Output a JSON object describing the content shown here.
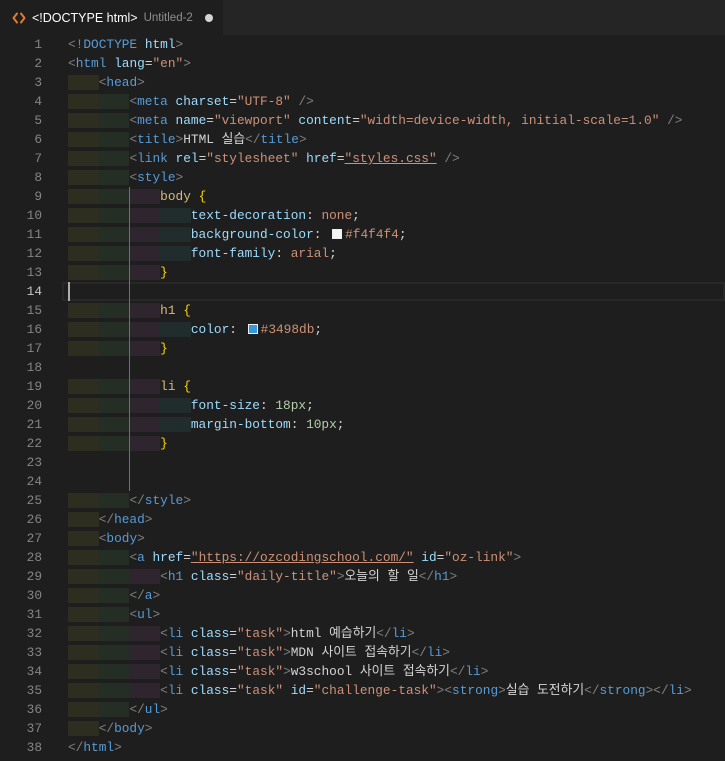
{
  "tab": {
    "icon": "html-file-icon",
    "title": "<!DOCTYPE html>",
    "file_name": "Untitled-2",
    "unsaved": true
  },
  "editor": {
    "active_line": 14,
    "lines": [
      {
        "n": 1,
        "tokens": [
          {
            "p": "<!"
          },
          {
            "tag": "DOCTYPE"
          },
          {
            "t": " "
          },
          {
            "attr": "html"
          },
          {
            "p": ">"
          }
        ]
      },
      {
        "n": 2,
        "tokens": [
          {
            "p": "<"
          },
          {
            "tag": "html"
          },
          {
            "t": " "
          },
          {
            "attr": "lang"
          },
          {
            "t": "="
          },
          {
            "str": "\"en\""
          },
          {
            "p": ">"
          }
        ]
      },
      {
        "n": 3,
        "tokens": [
          {
            "ws": "    "
          },
          {
            "p": "<"
          },
          {
            "tag": "head"
          },
          {
            "p": ">"
          }
        ]
      },
      {
        "n": 4,
        "tokens": [
          {
            "ws": "        "
          },
          {
            "p": "<"
          },
          {
            "tag": "meta"
          },
          {
            "t": " "
          },
          {
            "attr": "charset"
          },
          {
            "t": "="
          },
          {
            "str": "\"UTF-8\""
          },
          {
            "t": " "
          },
          {
            "p": "/>"
          }
        ]
      },
      {
        "n": 5,
        "tokens": [
          {
            "ws": "        "
          },
          {
            "p": "<"
          },
          {
            "tag": "meta"
          },
          {
            "t": " "
          },
          {
            "attr": "name"
          },
          {
            "t": "="
          },
          {
            "str": "\"viewport\""
          },
          {
            "t": " "
          },
          {
            "attr": "content"
          },
          {
            "t": "="
          },
          {
            "str": "\"width=device-width, initial-scale=1.0\""
          },
          {
            "t": " "
          },
          {
            "p": "/>"
          }
        ]
      },
      {
        "n": 6,
        "tokens": [
          {
            "ws": "        "
          },
          {
            "p": "<"
          },
          {
            "tag": "title"
          },
          {
            "p": ">"
          },
          {
            "t": "HTML 실습"
          },
          {
            "p": "</"
          },
          {
            "tag": "title"
          },
          {
            "p": ">"
          }
        ]
      },
      {
        "n": 7,
        "tokens": [
          {
            "ws": "        "
          },
          {
            "p": "<"
          },
          {
            "tag": "link"
          },
          {
            "t": " "
          },
          {
            "attr": "rel"
          },
          {
            "t": "="
          },
          {
            "str": "\"stylesheet\""
          },
          {
            "t": " "
          },
          {
            "attr": "href"
          },
          {
            "t": "="
          },
          {
            "link": "\"styles.css\""
          },
          {
            "t": " "
          },
          {
            "p": "/>"
          }
        ]
      },
      {
        "n": 8,
        "tokens": [
          {
            "ws": "        "
          },
          {
            "p": "<"
          },
          {
            "tag": "style"
          },
          {
            "p": ">"
          }
        ]
      },
      {
        "n": 9,
        "tokens": [
          {
            "ws": "            "
          },
          {
            "sel": "body"
          },
          {
            "t": " "
          },
          {
            "br": "{"
          }
        ]
      },
      {
        "n": 10,
        "tokens": [
          {
            "ws": "                "
          },
          {
            "prop": "text-decoration"
          },
          {
            "t": ": "
          },
          {
            "val": "none"
          },
          {
            "t": ";"
          }
        ]
      },
      {
        "n": 11,
        "tokens": [
          {
            "ws": "                "
          },
          {
            "prop": "background-color"
          },
          {
            "t": ": "
          },
          {
            "swatch": "#f4f4f4"
          },
          {
            "val": "#f4f4f4"
          },
          {
            "t": ";"
          }
        ]
      },
      {
        "n": 12,
        "tokens": [
          {
            "ws": "                "
          },
          {
            "prop": "font-family"
          },
          {
            "t": ": "
          },
          {
            "val": "arial"
          },
          {
            "t": ";"
          }
        ]
      },
      {
        "n": 13,
        "tokens": [
          {
            "ws": "            "
          },
          {
            "br": "}"
          }
        ]
      },
      {
        "n": 14,
        "tokens": []
      },
      {
        "n": 15,
        "tokens": [
          {
            "ws": "            "
          },
          {
            "sel": "h1"
          },
          {
            "t": " "
          },
          {
            "br": "{"
          }
        ]
      },
      {
        "n": 16,
        "tokens": [
          {
            "ws": "                "
          },
          {
            "prop": "color"
          },
          {
            "t": ": "
          },
          {
            "swatch": "#3498db"
          },
          {
            "val": "#3498db"
          },
          {
            "t": ";"
          }
        ]
      },
      {
        "n": 17,
        "tokens": [
          {
            "ws": "            "
          },
          {
            "br": "}"
          }
        ]
      },
      {
        "n": 18,
        "tokens": []
      },
      {
        "n": 19,
        "tokens": [
          {
            "ws": "            "
          },
          {
            "sel": "li"
          },
          {
            "t": " "
          },
          {
            "br": "{"
          }
        ]
      },
      {
        "n": 20,
        "tokens": [
          {
            "ws": "                "
          },
          {
            "prop": "font-size"
          },
          {
            "t": ": "
          },
          {
            "num": "18px"
          },
          {
            "t": ";"
          }
        ]
      },
      {
        "n": 21,
        "tokens": [
          {
            "ws": "                "
          },
          {
            "prop": "margin-bottom"
          },
          {
            "t": ": "
          },
          {
            "num": "10px"
          },
          {
            "t": ";"
          }
        ]
      },
      {
        "n": 22,
        "tokens": [
          {
            "ws": "            "
          },
          {
            "br": "}"
          }
        ]
      },
      {
        "n": 23,
        "tokens": []
      },
      {
        "n": 24,
        "tokens": []
      },
      {
        "n": 25,
        "tokens": [
          {
            "ws": "        "
          },
          {
            "p": "</"
          },
          {
            "tag": "style"
          },
          {
            "p": ">"
          }
        ]
      },
      {
        "n": 26,
        "tokens": [
          {
            "ws": "    "
          },
          {
            "p": "</"
          },
          {
            "tag": "head"
          },
          {
            "p": ">"
          }
        ]
      },
      {
        "n": 27,
        "tokens": [
          {
            "ws": "    "
          },
          {
            "p": "<"
          },
          {
            "tag": "body"
          },
          {
            "p": ">"
          }
        ]
      },
      {
        "n": 28,
        "tokens": [
          {
            "ws": "        "
          },
          {
            "p": "<"
          },
          {
            "tag": "a"
          },
          {
            "t": " "
          },
          {
            "attr": "href"
          },
          {
            "t": "="
          },
          {
            "link": "\"https://ozcodingschool.com/\""
          },
          {
            "t": " "
          },
          {
            "attr": "id"
          },
          {
            "t": "="
          },
          {
            "str": "\"oz-link\""
          },
          {
            "p": ">"
          }
        ]
      },
      {
        "n": 29,
        "tokens": [
          {
            "ws": "            "
          },
          {
            "p": "<"
          },
          {
            "tag": "h1"
          },
          {
            "t": " "
          },
          {
            "attr": "class"
          },
          {
            "t": "="
          },
          {
            "str": "\"daily-title\""
          },
          {
            "p": ">"
          },
          {
            "t": "오늘의 할 일"
          },
          {
            "p": "</"
          },
          {
            "tag": "h1"
          },
          {
            "p": ">"
          }
        ]
      },
      {
        "n": 30,
        "tokens": [
          {
            "ws": "        "
          },
          {
            "p": "</"
          },
          {
            "tag": "a"
          },
          {
            "p": ">"
          }
        ]
      },
      {
        "n": 31,
        "tokens": [
          {
            "ws": "        "
          },
          {
            "p": "<"
          },
          {
            "tag": "ul"
          },
          {
            "p": ">"
          }
        ]
      },
      {
        "n": 32,
        "tokens": [
          {
            "ws": "            "
          },
          {
            "p": "<"
          },
          {
            "tag": "li"
          },
          {
            "t": " "
          },
          {
            "attr": "class"
          },
          {
            "t": "="
          },
          {
            "str": "\"task\""
          },
          {
            "p": ">"
          },
          {
            "t": "html 예습하기"
          },
          {
            "p": "</"
          },
          {
            "tag": "li"
          },
          {
            "p": ">"
          }
        ]
      },
      {
        "n": 33,
        "tokens": [
          {
            "ws": "            "
          },
          {
            "p": "<"
          },
          {
            "tag": "li"
          },
          {
            "t": " "
          },
          {
            "attr": "class"
          },
          {
            "t": "="
          },
          {
            "str": "\"task\""
          },
          {
            "p": ">"
          },
          {
            "t": "MDN 사이트 접속하기"
          },
          {
            "p": "</"
          },
          {
            "tag": "li"
          },
          {
            "p": ">"
          }
        ]
      },
      {
        "n": 34,
        "tokens": [
          {
            "ws": "            "
          },
          {
            "p": "<"
          },
          {
            "tag": "li"
          },
          {
            "t": " "
          },
          {
            "attr": "class"
          },
          {
            "t": "="
          },
          {
            "str": "\"task\""
          },
          {
            "p": ">"
          },
          {
            "t": "w3school 사이트 접속하기"
          },
          {
            "p": "</"
          },
          {
            "tag": "li"
          },
          {
            "p": ">"
          }
        ]
      },
      {
        "n": 35,
        "tokens": [
          {
            "ws": "            "
          },
          {
            "p": "<"
          },
          {
            "tag": "li"
          },
          {
            "t": " "
          },
          {
            "attr": "class"
          },
          {
            "t": "="
          },
          {
            "str": "\"task\""
          },
          {
            "t": " "
          },
          {
            "attr": "id"
          },
          {
            "t": "="
          },
          {
            "str": "\"challenge-task\""
          },
          {
            "p": ">"
          },
          {
            "p": "<"
          },
          {
            "tag": "strong"
          },
          {
            "p": ">"
          },
          {
            "t": "실습 도전하기"
          },
          {
            "p": "</"
          },
          {
            "tag": "strong"
          },
          {
            "p": ">"
          },
          {
            "p": "</"
          },
          {
            "tag": "li"
          },
          {
            "p": ">"
          }
        ]
      },
      {
        "n": 36,
        "tokens": [
          {
            "ws": "        "
          },
          {
            "p": "</"
          },
          {
            "tag": "ul"
          },
          {
            "p": ">"
          }
        ]
      },
      {
        "n": 37,
        "tokens": [
          {
            "ws": "    "
          },
          {
            "p": "</"
          },
          {
            "tag": "body"
          },
          {
            "p": ">"
          }
        ]
      },
      {
        "n": 38,
        "tokens": [
          {
            "p": "</"
          },
          {
            "tag": "html"
          },
          {
            "p": ">"
          }
        ]
      }
    ]
  },
  "theme": {
    "editor_background": "#1e1e1e",
    "tab_bar_background": "#252526",
    "line_number": "#858585",
    "line_number_active": "#c6c6c6",
    "current_line_border": "#282828",
    "cursor": "#aeafad",
    "active_indent_guide": "#707070",
    "file_icon": "#e37933",
    "syntax": {
      "p": "#808080",
      "tag": "#569cd6",
      "attr": "#9cdcfe",
      "t": "#d4d4d4",
      "str": "#ce9178",
      "link": "#ce9178",
      "sel": "#d7ba7d",
      "br": "#ffd700",
      "prop": "#9cdcfe",
      "val": "#ce9178",
      "num": "#b5cea8"
    },
    "indent_rainbow": [
      "#2e2e20",
      "#252e25",
      "#2e252e",
      "#212c2c"
    ]
  }
}
